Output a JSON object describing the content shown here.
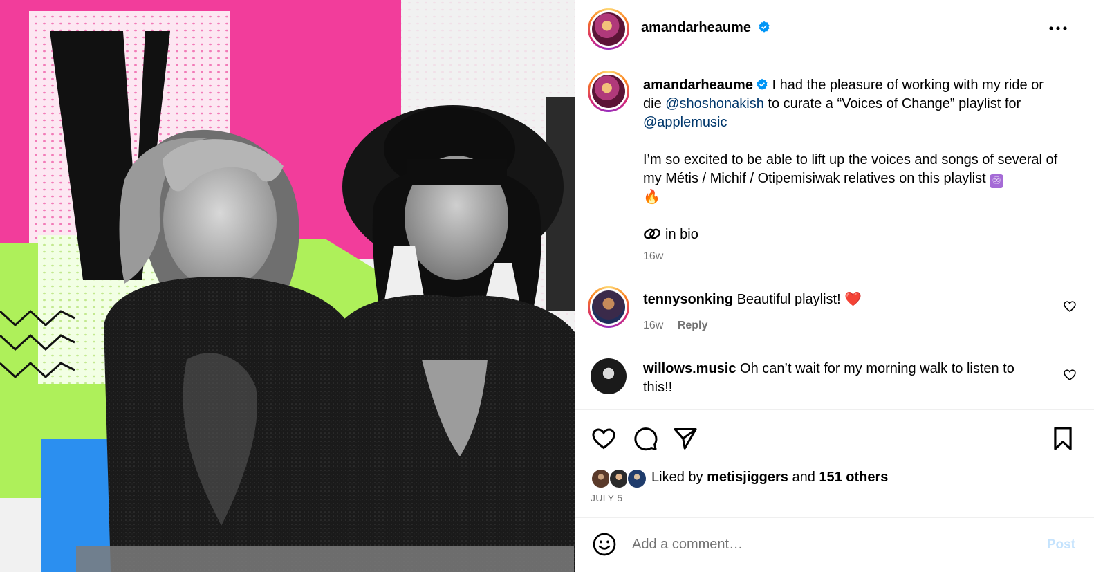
{
  "post": {
    "image_description_icon": "photo",
    "image_letter": "V"
  },
  "header": {
    "username": "amandarheaume",
    "verified_icon": "verified-badge-icon",
    "more_icon": "more-options-icon"
  },
  "caption": {
    "username": "amandarheaume",
    "line1_a": "I had the pleasure of working with my ride or die ",
    "mention1": "@shoshonakish",
    "line1_b": " to curate a “Voices of Change” playlist for ",
    "mention2": "@applemusic",
    "para2": "I’m so excited to be able to lift up the voices and songs of several of my Métis / Michif / Otipemisiwak relatives on this playlist ",
    "emoji_infinity": "♾",
    "emoji_fire": "🔥",
    "bio_text": "in bio",
    "time": "16w"
  },
  "comments": [
    {
      "username": "tennysonking",
      "text": "Beautiful playlist! ",
      "emoji": "❤️",
      "time": "16w",
      "reply": "Reply"
    },
    {
      "username": "willows.music",
      "text": "Oh can’t wait for my morning walk to listen to this!!"
    }
  ],
  "actions": {
    "liked_by_prefix": "Liked by ",
    "liked_by_user": "metisjiggers",
    "liked_and": " and ",
    "liked_others": "151 others",
    "date": "JULY 5"
  },
  "add_comment": {
    "placeholder": "Add a comment…",
    "post_label": "Post"
  },
  "colors": {
    "link": "#00376b",
    "muted": "#737373",
    "verified": "#0095f6",
    "heart": "#ff3040",
    "post_disabled": "#c5e3fd"
  }
}
